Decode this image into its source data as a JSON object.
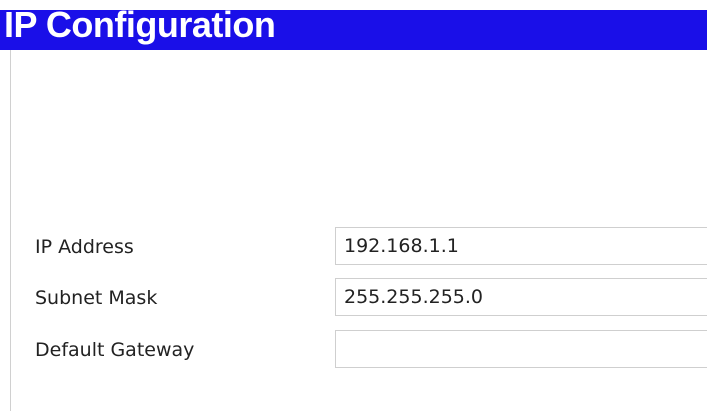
{
  "header": {
    "title": "IP Configuration"
  },
  "form": {
    "ip_address": {
      "label": "IP Address",
      "value": "192.168.1.1"
    },
    "subnet_mask": {
      "label": "Subnet Mask",
      "value": "255.255.255.0"
    },
    "default_gateway": {
      "label": "Default Gateway",
      "value": ""
    }
  },
  "colors": {
    "title_bar": "#1a0fe8",
    "title_text": "#ffffff",
    "field_border": "#cfcfcf"
  }
}
